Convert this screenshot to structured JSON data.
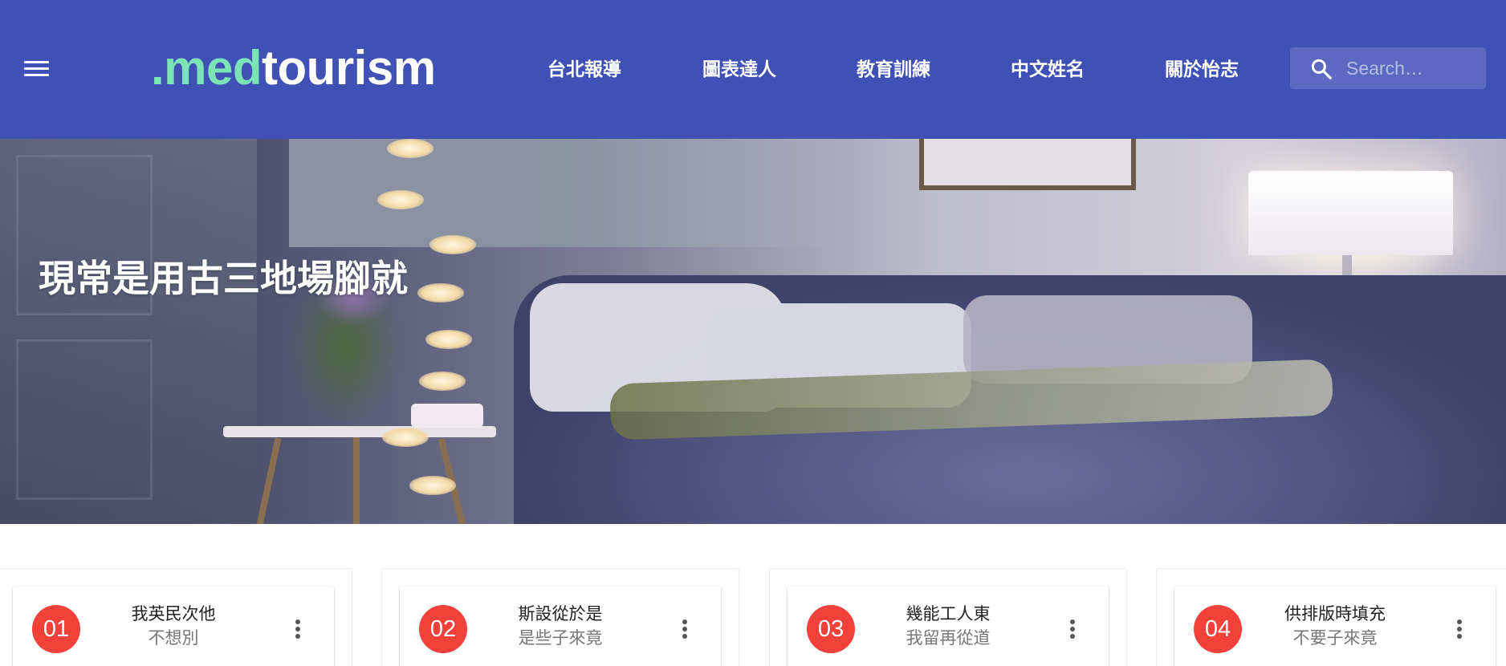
{
  "header": {
    "logo": {
      "accent": ".med",
      "rest": "tourism"
    },
    "nav": [
      {
        "label": "台北報導"
      },
      {
        "label": "圖表達人"
      },
      {
        "label": "教育訓練"
      },
      {
        "label": "中文姓名"
      },
      {
        "label": "關於怡志"
      }
    ],
    "search": {
      "placeholder": "Search…"
    }
  },
  "hero": {
    "title": "現常是用古三地場腳就"
  },
  "cards": [
    {
      "number": "01",
      "title": "我英民次他",
      "subtitle": "不想別"
    },
    {
      "number": "02",
      "title": "斯設從於是",
      "subtitle": "是些子來竟"
    },
    {
      "number": "03",
      "title": "幾能工人東",
      "subtitle": "我留再從道"
    },
    {
      "number": "04",
      "title": "供排版時填充",
      "subtitle": "不要子來竟"
    }
  ],
  "colors": {
    "appbar": "#3f51b5",
    "logo_accent": "#7be3b6",
    "badge": "#f2413b"
  }
}
